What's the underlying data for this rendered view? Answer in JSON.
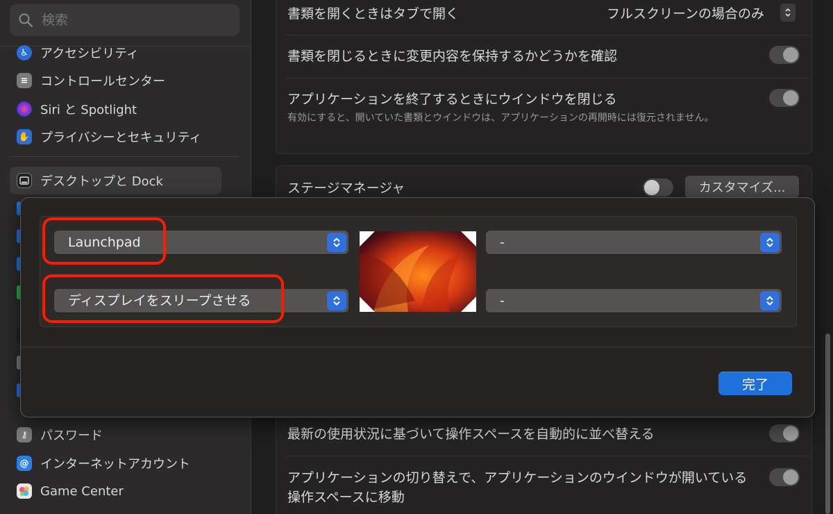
{
  "sidebar": {
    "search_placeholder": "検索",
    "items": [
      {
        "label": "アクセシビリティ",
        "icon": "accessibility-icon",
        "color": "#2b6fd6"
      },
      {
        "label": "コントロールセンター",
        "icon": "control-center-icon",
        "color": "#7b7b7b"
      },
      {
        "label": "Siri と Spotlight",
        "icon": "siri-icon",
        "color": "#8a3fd1"
      },
      {
        "label": "プライバシーとセキュリティ",
        "icon": "hand-icon",
        "color": "#2b6fd6"
      },
      {
        "label": "デスクトップと Dock",
        "icon": "dock-icon",
        "color": "#222222"
      },
      {
        "label": "パスワード",
        "icon": "key-icon",
        "color": "#7b7b7b"
      },
      {
        "label": "インターネットアカウント",
        "icon": "at-icon",
        "color": "#2b7de9"
      },
      {
        "label": "Game Center",
        "icon": "game-center-icon",
        "color": "#e8e8e8"
      }
    ]
  },
  "settings": {
    "open_tabs_label": "書類を開くときはタブで開く",
    "open_tabs_value": "フルスクリーンの場合のみ",
    "confirm_changes_label": "書類を閉じるときに変更内容を保持するかどうかを確認",
    "close_windows_label": "アプリケーションを終了するときにウインドウを閉じる",
    "close_windows_desc": "有効にすると、開いていた書類とウインドウは、アプリケーションの再開時には復元されません。",
    "stage_manager_label": "ステージマネージャ",
    "customize_label": "カスタマイズ...",
    "rearrange_label": "最新の使用状況に基づいて操作スペースを自動的に並べ替える",
    "switch_space_label": "アプリケーションの切り替えで、アプリケーションのウインドウが開いている操作スペースに移動"
  },
  "hot_corners": {
    "top_left": "Launchpad",
    "bottom_left": "ディスプレイをスリープさせる",
    "top_right": "-",
    "bottom_right": "-",
    "done_label": "完了",
    "accent": "#1f6fdc",
    "highlight_color": "#ff1a00"
  }
}
